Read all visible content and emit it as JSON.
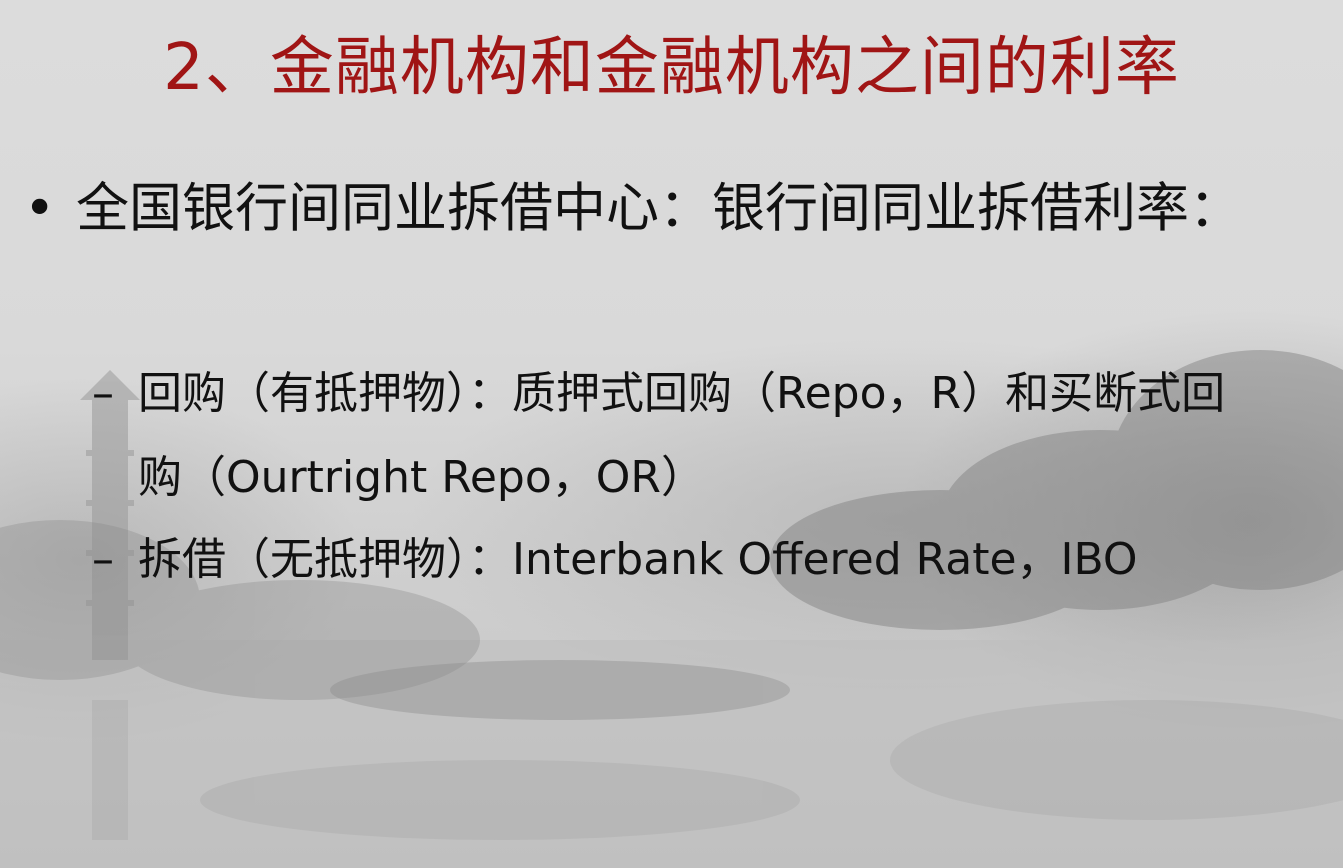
{
  "slide": {
    "title": "2、金融机构和金融机构之间的利率",
    "bullet_marker": "•",
    "bullet_text": "全国银行间同业拆借中心：银行间同业拆借利率：",
    "sub_marker": "–",
    "sub_items": [
      "回购（有抵押物）：质押式回购（Repo，R）和买断式回购（Ourtright Repo，OR）",
      "拆借（无抵押物）：Interbank Offered Rate，IBO"
    ]
  },
  "colors": {
    "title": "#a01515",
    "body_text": "#111111",
    "background": "#d6d6d6"
  }
}
